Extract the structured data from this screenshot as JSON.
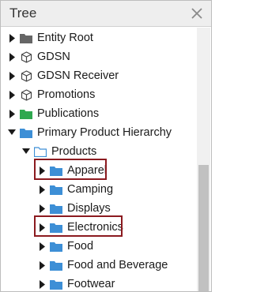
{
  "panel": {
    "title": "Tree",
    "close_icon": "close-icon"
  },
  "tree": {
    "items": [
      {
        "label": "Entity Root",
        "icon": "folder-dark-icon",
        "expanded": false
      },
      {
        "label": "GDSN",
        "icon": "cube-icon",
        "expanded": false
      },
      {
        "label": "GDSN Receiver",
        "icon": "cube-icon",
        "expanded": false
      },
      {
        "label": "Promotions",
        "icon": "cube-icon",
        "expanded": false
      },
      {
        "label": "Publications",
        "icon": "folder-green-icon",
        "expanded": false
      },
      {
        "label": "Primary Product Hierarchy",
        "icon": "folder-blue-icon",
        "expanded": true
      },
      {
        "label": "Products",
        "icon": "folder-blue-icon",
        "expanded": true
      },
      {
        "label": "Apparel",
        "icon": "folder-blue-icon",
        "expanded": false,
        "highlighted": true
      },
      {
        "label": "Camping",
        "icon": "folder-blue-icon",
        "expanded": false
      },
      {
        "label": "Displays",
        "icon": "folder-blue-icon",
        "expanded": false
      },
      {
        "label": "Electronics",
        "icon": "folder-blue-icon",
        "expanded": false,
        "highlighted": true
      },
      {
        "label": "Food",
        "icon": "folder-blue-icon",
        "expanded": false
      },
      {
        "label": "Food and Beverage",
        "icon": "folder-blue-icon",
        "expanded": false
      },
      {
        "label": "Footwear",
        "icon": "folder-blue-icon",
        "expanded": false
      }
    ]
  },
  "colors": {
    "highlight_border": "#8b1a1f",
    "folder_blue": "#3d8fd6",
    "folder_green": "#2fa84f",
    "folder_dark": "#666666"
  }
}
